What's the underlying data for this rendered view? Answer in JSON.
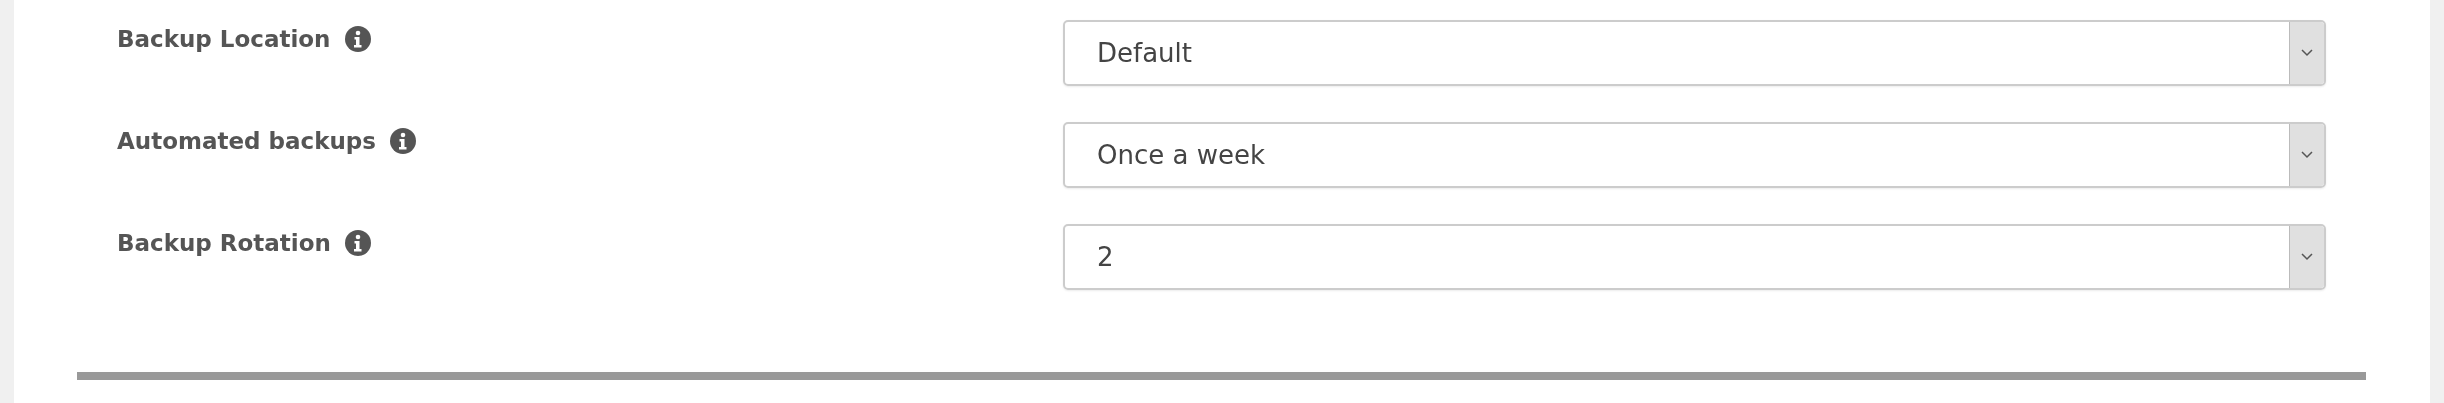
{
  "settings": [
    {
      "label": "Backup Location",
      "value": "Default"
    },
    {
      "label": "Automated backups",
      "value": "Once a week"
    },
    {
      "label": "Backup Rotation",
      "value": "2"
    }
  ]
}
